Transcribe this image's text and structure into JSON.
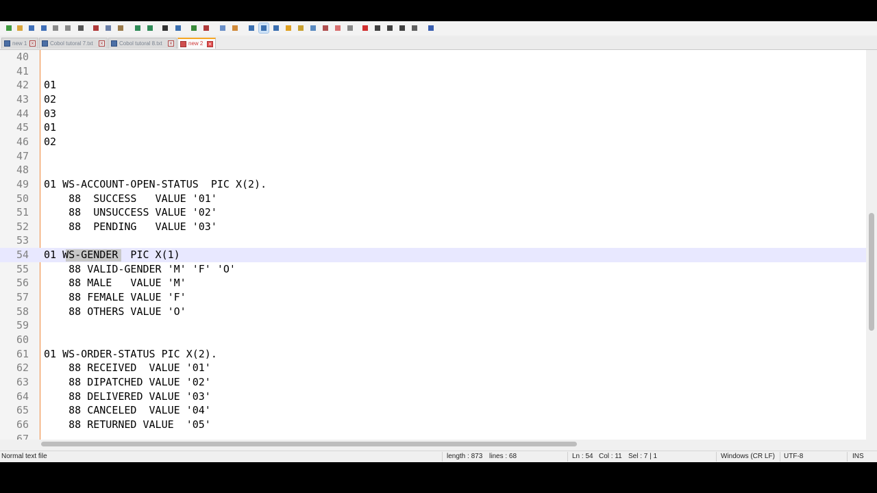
{
  "toolbar": {
    "buttons": [
      {
        "name": "new-file-icon",
        "color": "#3f9b3f"
      },
      {
        "name": "open-file-icon",
        "color": "#d9a53a"
      },
      {
        "name": "save-icon",
        "color": "#3f6fb8"
      },
      {
        "name": "save-all-icon",
        "color": "#3f6fb8"
      },
      {
        "name": "close-icon",
        "color": "#8a8a8a"
      },
      {
        "name": "close-all-icon",
        "color": "#8a8a8a"
      },
      {
        "name": "print-icon",
        "color": "#555555"
      },
      {
        "name": "cut-icon",
        "color": "#b03a3a"
      },
      {
        "name": "copy-icon",
        "color": "#6a7fa8"
      },
      {
        "name": "paste-icon",
        "color": "#9a7a4a"
      },
      {
        "name": "undo-icon",
        "color": "#2e8b57"
      },
      {
        "name": "redo-icon",
        "color": "#2e8b57"
      },
      {
        "name": "find-icon",
        "color": "#333333"
      },
      {
        "name": "replace-icon",
        "color": "#3a6fb0"
      },
      {
        "name": "zoom-in-icon",
        "color": "#3a8a3a"
      },
      {
        "name": "zoom-out-icon",
        "color": "#b03a3a"
      },
      {
        "name": "sync-vertical-icon",
        "color": "#6a8fc8"
      },
      {
        "name": "sync-horizontal-icon",
        "color": "#d08a3a"
      },
      {
        "name": "word-wrap-icon",
        "color": "#3a6fb0"
      },
      {
        "name": "show-all-characters-icon",
        "color": "#3a6fb0"
      },
      {
        "name": "indent-guide-icon",
        "color": "#3a6fb0"
      },
      {
        "name": "user-language-icon",
        "color": "#e0a020"
      },
      {
        "name": "doc-map-icon",
        "color": "#c8a030"
      },
      {
        "name": "function-list-icon",
        "color": "#5a8ac0"
      },
      {
        "name": "folder-workspace-icon",
        "color": "#b05050"
      },
      {
        "name": "document-monitor-icon",
        "color": "#d87070"
      },
      {
        "name": "monitor-icon",
        "color": "#888888"
      },
      {
        "name": "record-macro-icon",
        "color": "#d03030"
      },
      {
        "name": "stop-macro-icon",
        "color": "#404040"
      },
      {
        "name": "play-macro-icon",
        "color": "#404040"
      },
      {
        "name": "run-macro-multiple-icon",
        "color": "#404040"
      },
      {
        "name": "save-macro-icon",
        "color": "#606060"
      },
      {
        "name": "spell-check-icon",
        "color": "#3a5fb0"
      }
    ]
  },
  "tabs": [
    {
      "label": "new 1",
      "active": false
    },
    {
      "label": "Cobol tutoral 7.txt",
      "active": false
    },
    {
      "label": "Cobol tutoral 8.txt",
      "active": false
    },
    {
      "label": "new 2",
      "active": true
    }
  ],
  "editor": {
    "current_line": 54,
    "selection_text": "WS-GEND",
    "lines": [
      {
        "n": "40",
        "text": ""
      },
      {
        "n": "41",
        "text": ""
      },
      {
        "n": "42",
        "text": "01"
      },
      {
        "n": "43",
        "text": "02"
      },
      {
        "n": "44",
        "text": "03"
      },
      {
        "n": "45",
        "text": "01"
      },
      {
        "n": "46",
        "text": "02"
      },
      {
        "n": "47",
        "text": ""
      },
      {
        "n": "48",
        "text": ""
      },
      {
        "n": "49",
        "text": "01 WS-ACCOUNT-OPEN-STATUS  PIC X(2)."
      },
      {
        "n": "50",
        "text": "    88  SUCCESS   VALUE '01'"
      },
      {
        "n": "51",
        "text": "    88  UNSUCCESS VALUE '02'"
      },
      {
        "n": "52",
        "text": "    88  PENDING   VALUE '03'"
      },
      {
        "n": "53",
        "text": ""
      },
      {
        "n": "54",
        "text": "01 WS-GENDER  PIC X(1)"
      },
      {
        "n": "55",
        "text": "    88 VALID-GENDER 'M' 'F' 'O'"
      },
      {
        "n": "56",
        "text": "    88 MALE   VALUE 'M'"
      },
      {
        "n": "57",
        "text": "    88 FEMALE VALUE 'F'"
      },
      {
        "n": "58",
        "text": "    88 OTHERS VALUE 'O'"
      },
      {
        "n": "59",
        "text": ""
      },
      {
        "n": "60",
        "text": ""
      },
      {
        "n": "61",
        "text": "01 WS-ORDER-STATUS PIC X(2)."
      },
      {
        "n": "62",
        "text": "    88 RECEIVED  VALUE '01'"
      },
      {
        "n": "63",
        "text": "    88 DIPATCHED VALUE '02'"
      },
      {
        "n": "64",
        "text": "    88 DELIVERED VALUE '03'"
      },
      {
        "n": "65",
        "text": "    88 CANCELED  VALUE '04'"
      },
      {
        "n": "66",
        "text": "    88 RETURNED VALUE  '05'"
      },
      {
        "n": "67",
        "text": ""
      }
    ]
  },
  "status": {
    "file_type": "Normal text file",
    "length": "length : 873",
    "lines": "lines : 68",
    "ln": "Ln : 54",
    "col": "Col : 11",
    "sel": "Sel : 7 | 1",
    "eol": "Windows (CR LF)",
    "encoding": "UTF-8",
    "mode": "INS"
  },
  "colors": {
    "current_line_bg": "#e8e8ff",
    "selection_bg": "#c8c8c8",
    "fold_margin": "#f0883a",
    "active_tab_text": "#d03a3a",
    "active_tab_accent": "#f5a623"
  }
}
